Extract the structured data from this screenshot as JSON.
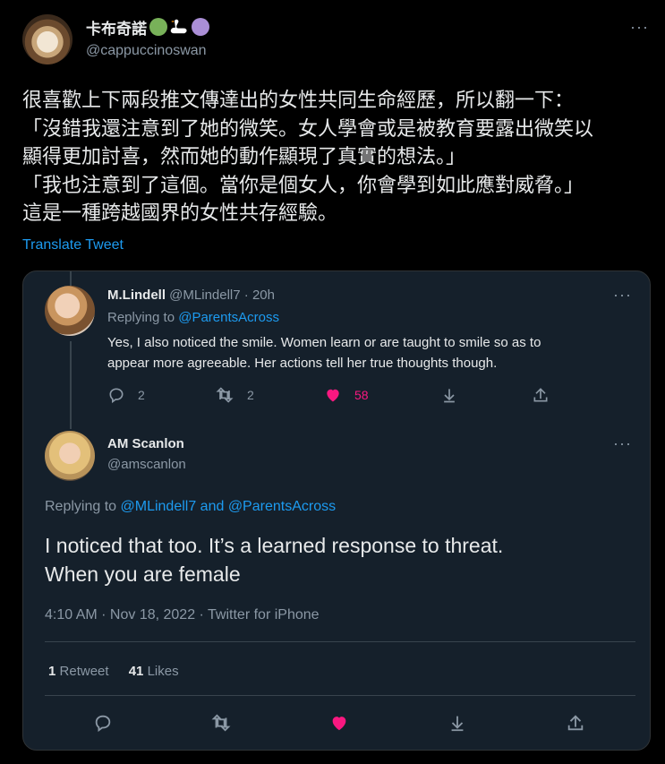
{
  "main_tweet": {
    "display_name": "卡布奇諾",
    "name_emojis": [
      "green-circle",
      "swan",
      "purple-circle"
    ],
    "handle": "@cappuccinoswan",
    "text_lines": [
      "很喜歡上下兩段推文傳達出的女性共同生命經歷，所以翻一下：",
      "「沒錯我還注意到了她的微笑。女人學會或是被教育要露出微笑以",
      "顯得更加討喜，然而她的動作顯現了真實的想法。」",
      "「我也注意到了這個。當你是個女人，你會學到如此應對威脅。」",
      "這是一種跨越國界的女性共存經驗。"
    ],
    "translate_label": "Translate Tweet",
    "more": "···"
  },
  "quoted": {
    "parent": {
      "display_name": "M.Lindell",
      "handle": "@MLindell7",
      "dot": "·",
      "time": "20h",
      "replying_prefix": "Replying to",
      "replying_to": "@ParentsAcross",
      "text_lines": [
        "Yes, I also noticed the smile. Women learn or are taught to smile so as to",
        "appear more agreeable. Her actions tell her true thoughts though."
      ],
      "reply_count": "2",
      "retweet_count": "2",
      "like_count": "58",
      "more": "···"
    },
    "reply": {
      "display_name": "AM Scanlon",
      "handle": "@amscanlon",
      "replying_prefix": "Replying to",
      "replying_to": "@MLindell7 and @ParentsAcross",
      "text_lines": [
        "I noticed that too. It’s a learned response to threat.",
        "When you are female"
      ],
      "timestamp": "4:10 AM · Nov 18, 2022 · Twitter for iPhone",
      "retweet_count": "1",
      "retweet_label": "Retweet",
      "like_count": "41",
      "like_label": "Likes",
      "more": "···"
    }
  },
  "colors": {
    "background": "#000000",
    "card_background": "#15202b",
    "text": "#e7e9ea",
    "muted": "#8b98a5",
    "link": "#1d9bf0",
    "like": "#f91880"
  }
}
